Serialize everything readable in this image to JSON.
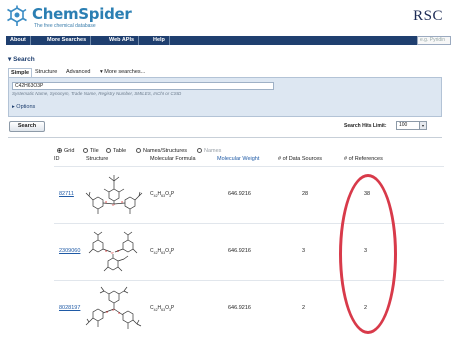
{
  "header": {
    "app_title": "ChemSpider",
    "tagline": "The free chemical database",
    "publisher": "RSC"
  },
  "nav": {
    "items": [
      "About",
      "More Searches",
      "Web APIs",
      "Help"
    ],
    "search_box": "e.g. Pyridin"
  },
  "search": {
    "section_title": "Search",
    "tabs": [
      "Simple",
      "Structure",
      "Advanced",
      "More searches..."
    ],
    "query_value": "C42H63O3P",
    "hint": "Systematic Name, Synonym, Trade Name, Registry Number, SMILES, InChI or CSID",
    "options_label": "Options",
    "search_button": "Search",
    "hit_limit_label": "Search Hits Limit:",
    "hit_limit_value": "100"
  },
  "view_options": {
    "items": [
      "Grid",
      "Tile",
      "Table",
      "Names/Structures",
      "Names"
    ],
    "selected": "Grid"
  },
  "results": {
    "columns": [
      "ID",
      "Structure",
      "Molecular Formula",
      "Molecular Weight",
      "# of Data Sources",
      "# of References"
    ],
    "formula_parts": {
      "c": "42",
      "h": "63",
      "o": "3",
      "p": "P"
    },
    "rows": [
      {
        "id": "82711",
        "formula": "C42H63O3P",
        "mw": "646.9216",
        "sources": "28",
        "references": "38"
      },
      {
        "id": "2309060",
        "formula": "C42H63O3P",
        "mw": "646.9216",
        "sources": "3",
        "references": "3"
      },
      {
        "id": "8028197",
        "formula": "C42H63O3P",
        "mw": "646.9216",
        "sources": "2",
        "references": "2"
      }
    ]
  },
  "colors": {
    "brand_blue": "#2b7fb3",
    "nav_bg": "#1f3f6f",
    "panel_bg": "#dde7f2",
    "link": "#1f5aa6",
    "highlight": "#d83a4a"
  },
  "icons": [
    "chemspider-logo-icon",
    "collapse-triangle-icon",
    "expand-triangle-icon",
    "dropdown-arrow-icon",
    "radio-icon"
  ]
}
